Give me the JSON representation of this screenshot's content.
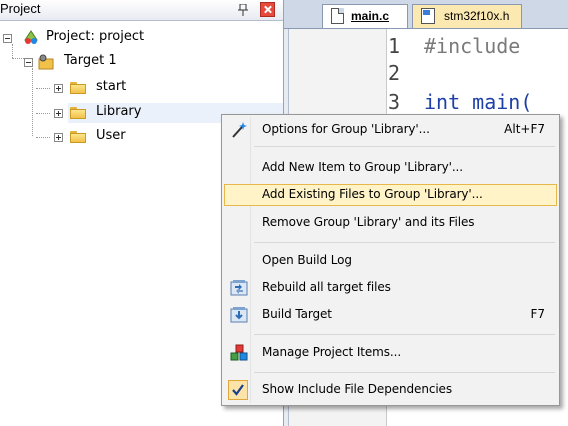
{
  "project_panel": {
    "title": "Project",
    "tree": {
      "root": "Project: project",
      "target": "Target 1",
      "groups": [
        "start",
        "Library",
        "User"
      ]
    }
  },
  "editor": {
    "tabs": [
      {
        "label": "main.c",
        "active": true
      },
      {
        "label": "stm32f10x.h",
        "active": false
      }
    ],
    "line_numbers": [
      "1",
      "2",
      "3"
    ],
    "code_lines": [
      "#include",
      "",
      "int main("
    ]
  },
  "context_menu": {
    "items": [
      {
        "label": "Options for Group 'Library'...",
        "shortcut": "Alt+F7",
        "icon": "options-wand-icon"
      },
      {
        "label": "Add New  Item to Group 'Library'...",
        "shortcut": ""
      },
      {
        "label": "Add Existing Files to Group 'Library'...",
        "shortcut": "",
        "highlighted": true
      },
      {
        "label": "Remove Group 'Library' and its Files",
        "shortcut": ""
      },
      {
        "label": "Open Build Log",
        "shortcut": ""
      },
      {
        "label": "Rebuild all target files",
        "shortcut": "",
        "icon": "rebuild-icon"
      },
      {
        "label": "Build Target",
        "shortcut": "F7",
        "icon": "build-icon"
      },
      {
        "label": "Manage Project Items...",
        "shortcut": "",
        "icon": "manage-items-icon"
      },
      {
        "label": "Show Include File Dependencies",
        "shortcut": "",
        "checked": true
      }
    ]
  },
  "colors": {
    "menu_highlight": "#fff3c7",
    "menu_highlight_border": "#e6b84a",
    "code_keyword": "#1f3fa8",
    "code_preprocessor": "#7a7a7a"
  }
}
